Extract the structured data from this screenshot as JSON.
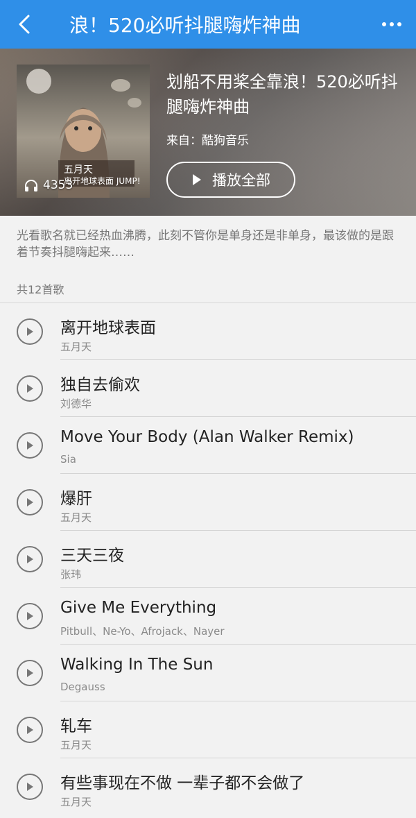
{
  "header": {
    "title": "浪！520必听抖腿嗨炸神曲"
  },
  "playlist": {
    "name": "划船不用桨全靠浪！520必听抖腿嗨炸神曲",
    "source": "来自：酷狗音乐",
    "play_count": "4353",
    "play_all_label": "播放全部",
    "cover_text": "五月天 离开地球表面 JUMP!",
    "description": "光看歌名就已经热血沸腾，此刻不管你是单身还是非单身，最该做的是跟着节奏抖腿嗨起来……",
    "song_count": "共12首歌"
  },
  "songs": [
    {
      "title": "离开地球表面",
      "artist": "五月天"
    },
    {
      "title": "独自去偷欢",
      "artist": "刘德华"
    },
    {
      "title": "Move Your Body (Alan Walker Remix)",
      "artist": "Sia"
    },
    {
      "title": "爆肝",
      "artist": "五月天"
    },
    {
      "title": "三天三夜",
      "artist": "张玮"
    },
    {
      "title": "Give Me Everything",
      "artist": "Pitbull、Ne-Yo、Afrojack、Nayer"
    },
    {
      "title": "Walking In The Sun",
      "artist": "Degauss"
    },
    {
      "title": "轧车",
      "artist": "五月天"
    },
    {
      "title": "有些事现在不做 一辈子都不会做了",
      "artist": "五月天"
    }
  ],
  "icons": {
    "back": "back-icon",
    "more": "more-icon",
    "headphones": "headphones-icon",
    "play": "play-icon"
  },
  "colors": {
    "accent": "#2f8fe8"
  }
}
